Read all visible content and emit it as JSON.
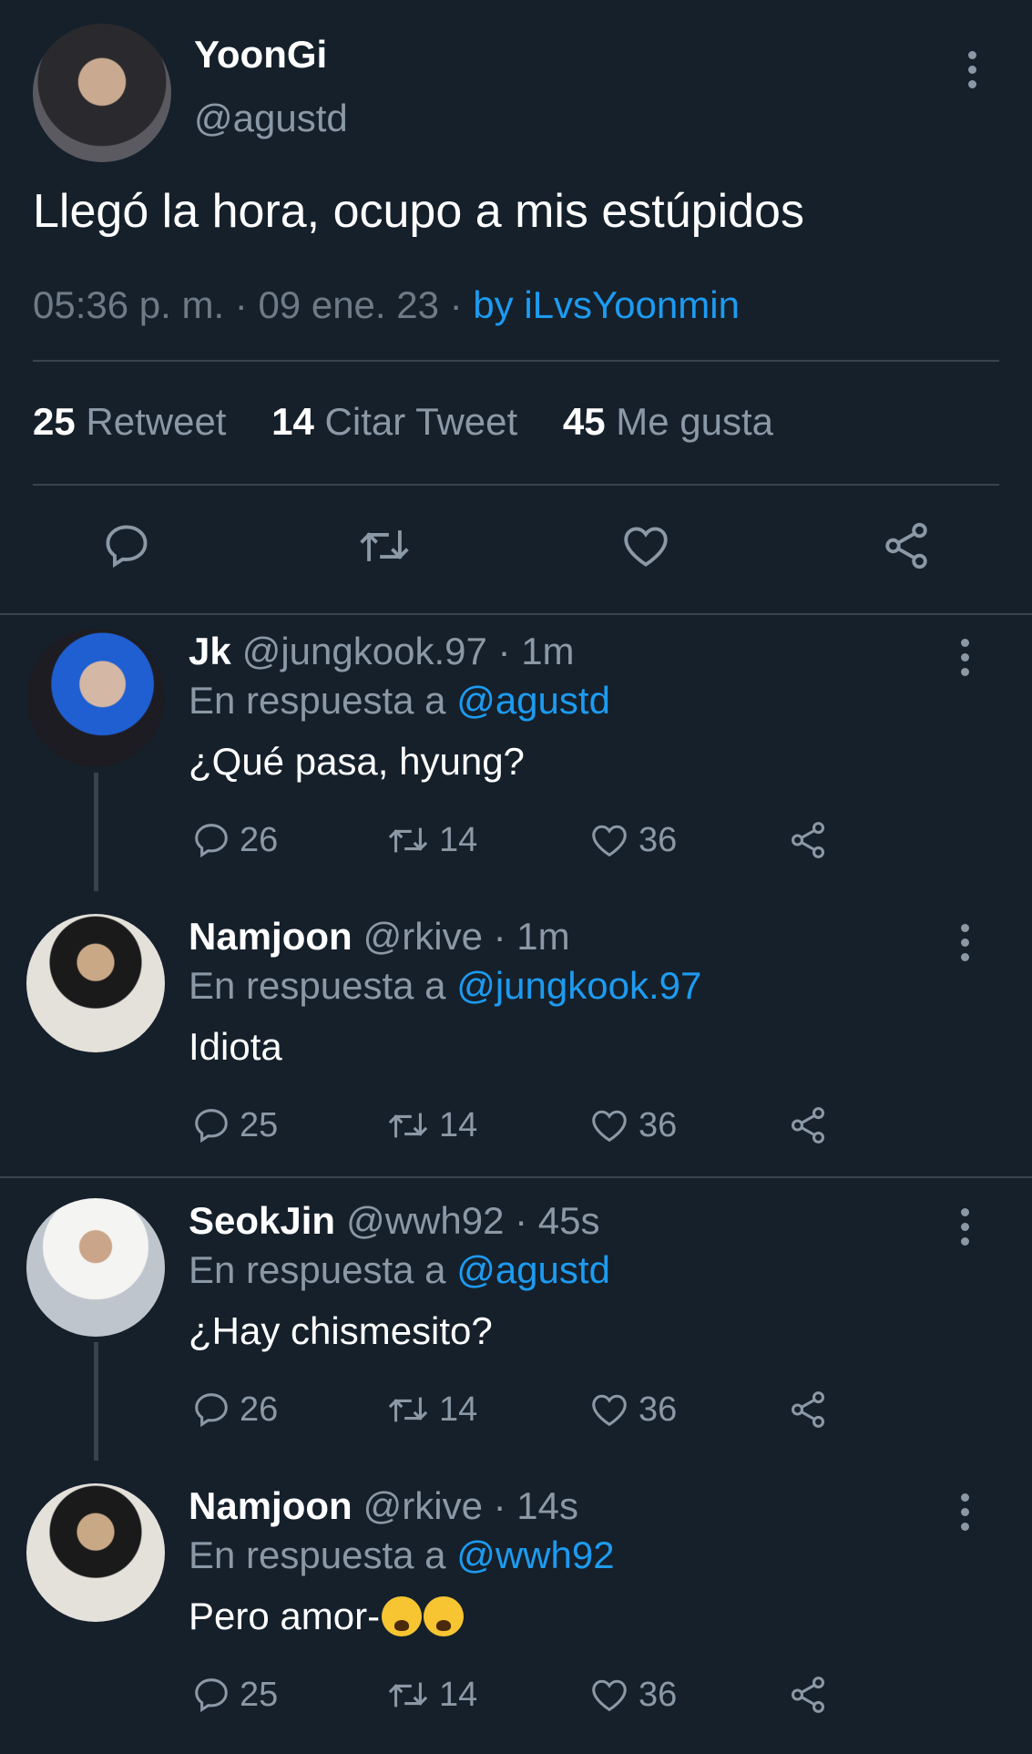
{
  "tweet": {
    "name": "YoonGi",
    "handle": "@agustd",
    "text": "Llegó la hora, ocupo a mis estúpidos",
    "time": "05:36 p. m. · 09 ene. 23 · ",
    "source": "by iLvsYoonmin",
    "stats": {
      "retweets": "25",
      "retweets_label": "Retweet",
      "quotes": "14",
      "quotes_label": "Citar Tweet",
      "likes": "45",
      "likes_label": "Me gusta"
    },
    "actions": [
      "reply-icon",
      "retweet-icon",
      "like-icon",
      "share-icon"
    ]
  },
  "replies": [
    {
      "name": "Jk",
      "handle": "@jungkook.97",
      "time": "· 1m",
      "reply_prefix": "En respuesta a ",
      "reply_to": "@agustd",
      "text": "¿Qué pasa, hyung?",
      "replies": "26",
      "retweets": "14",
      "likes": "36"
    },
    {
      "name": "Namjoon",
      "handle": "@rkive",
      "time": "· 1m",
      "reply_prefix": "En respuesta a ",
      "reply_to": "@jungkook.97",
      "text": "Idiota",
      "replies": "25",
      "retweets": "14",
      "likes": "36"
    },
    {
      "name": "SeokJin",
      "handle": "@wwh92",
      "time": "· 45s",
      "reply_prefix": "En respuesta a ",
      "reply_to": "@agustd",
      "text": "¿Hay chismesito?",
      "replies": "26",
      "retweets": "14",
      "likes": "36"
    },
    {
      "name": "Namjoon",
      "handle": "@rkive",
      "time": "· 14s",
      "reply_prefix": "En respuesta a ",
      "reply_to": "@wwh92",
      "text": "Pero amor-",
      "emoji": "loudly-crying-face",
      "replies": "25",
      "retweets": "14",
      "likes": "36"
    }
  ],
  "colors": {
    "background": "#15202b",
    "accent": "#1d9bf0",
    "muted": "#8b98a5",
    "divider": "#38444d"
  }
}
